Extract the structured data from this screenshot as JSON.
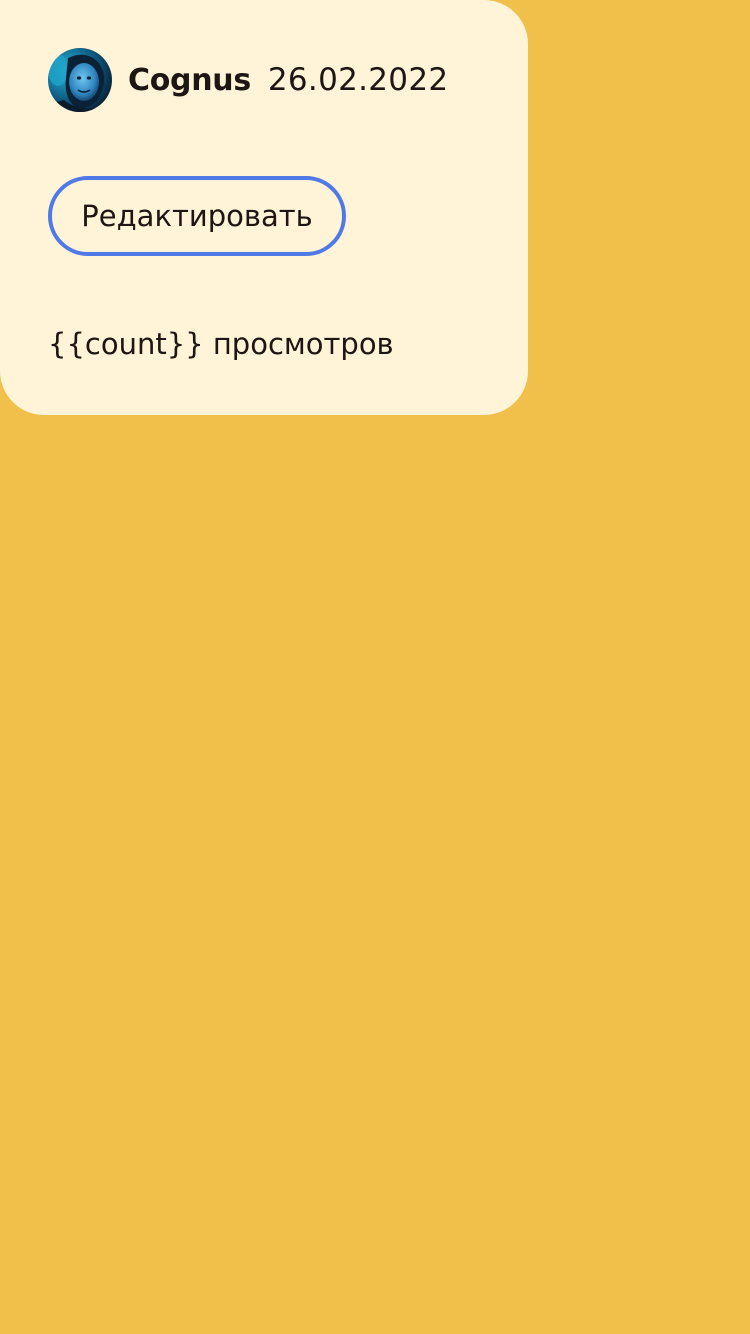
{
  "post": {
    "author": "Cognus",
    "date": "26.02.2022",
    "avatar_icon": "user-avatar",
    "edit_label": "Редактировать",
    "views_label": "{{count}} просмотров"
  },
  "colors": {
    "background": "#f0c04b",
    "card": "#fff3d8",
    "button_border": "#4f79e7",
    "text": "#1e1612"
  }
}
